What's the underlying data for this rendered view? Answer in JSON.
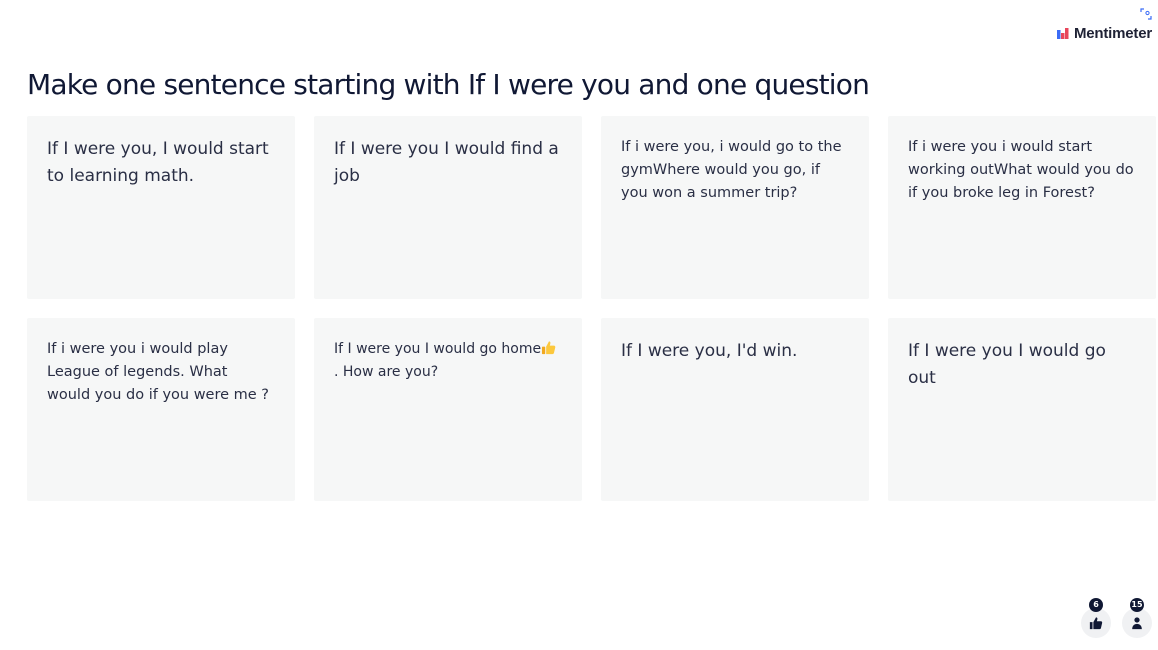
{
  "brand": {
    "name": "Mentimeter",
    "logo_colors": [
      "#e8465b",
      "#3b6cf6",
      "#f5a3b0"
    ]
  },
  "question": {
    "title": "Make one sentence starting with If I were you and one question"
  },
  "responses": [
    {
      "text": "If I were you, I would start to learning math.",
      "size": "large"
    },
    {
      "text": "If I were you I would find a job",
      "size": "large"
    },
    {
      "text": "If i were you, i would go to the gymWhere would you go, if you won a summer trip?",
      "size": "medium"
    },
    {
      "text": "If i were you i would start working outWhat would you do if you broke leg in Forest?",
      "size": "medium"
    },
    {
      "text": "If i were you i would play League of legends. What would you do if you were me ?",
      "size": "medium"
    },
    {
      "text_before": "If I were you I would go home",
      "emoji": "thumbs-up",
      "text_after": ". How are you?",
      "size": "small"
    },
    {
      "text": "If I were you, I'd win.",
      "size": "large"
    },
    {
      "text": "If I were you I would go out",
      "size": "large"
    }
  ],
  "footer": {
    "reactions_count": "6",
    "participants_count": "15",
    "reactions_icon": "thumbs-up-icon",
    "participants_icon": "person-icon"
  },
  "colors": {
    "card_background": "#f6f7f7",
    "text": "#101834",
    "badge": "#101834"
  }
}
